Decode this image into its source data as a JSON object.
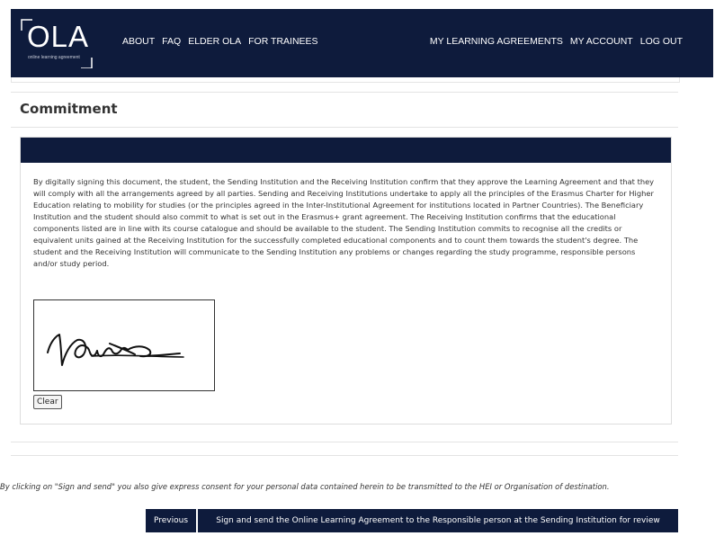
{
  "header": {
    "logo_text": "OLA",
    "logo_subtitle": "online learning agreement",
    "nav_left": [
      "ABOUT",
      "FAQ",
      "ELDER OLA",
      "FOR TRAINEES"
    ],
    "nav_right": [
      "MY LEARNING AGREEMENTS",
      "MY ACCOUNT",
      "LOG OUT"
    ]
  },
  "commitment": {
    "title": "Commitment",
    "text": "By digitally signing this document, the student, the Sending Institution and the Receiving Institution confirm that they approve the Learning Agreement and that they will comply with all the arrangements agreed by all parties. Sending and Receiving Institutions undertake to apply all the principles of the Erasmus Charter for Higher Education relating to mobility for studies (or the principles agreed in the Inter-Institutional Agreement for institutions located in Partner Countries). The Beneficiary Institution and the student should also commit to what is set out in the Erasmus+ grant agreement. The Receiving Institution confirms that the educational components listed are in line with its course catalogue and should be available to the student. The Sending Institution commits to recognise all the credits or equivalent units gained at the Receiving Institution for the successfully completed educational components and to count them towards the student's degree. The student and the Receiving Institution will communicate to the Sending Institution any problems or changes regarding the study programme, responsible persons and/or study period.",
    "clear_label": "Clear"
  },
  "consent_text": "By clicking on \"Sign and send\" you also give express consent for your personal data contained herein to be transmitted to the HEI or Organisation of destination.",
  "buttons": {
    "previous": "Previous",
    "sign_send": "Sign and send the Online Learning Agreement to the Responsible person at the Sending Institution for review"
  },
  "colors": {
    "navy": "#0e1b3c"
  }
}
